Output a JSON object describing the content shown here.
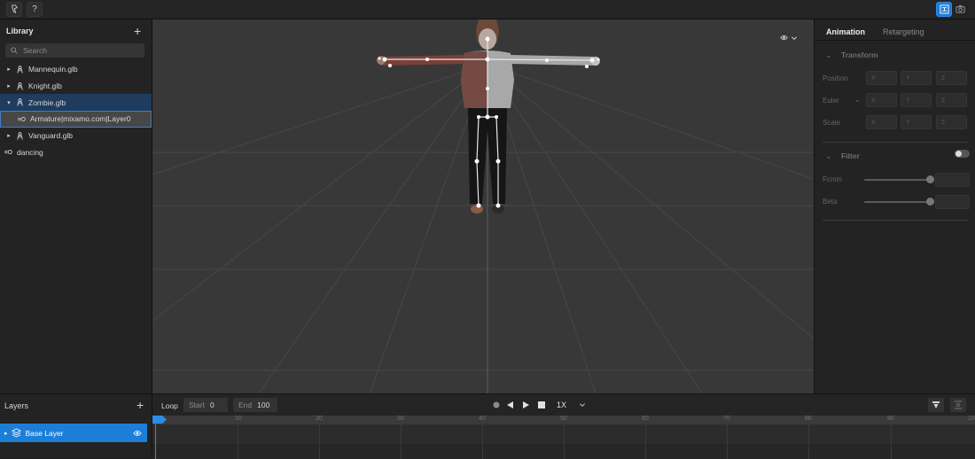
{
  "colors": {
    "accent": "#1e7bd6",
    "selected_row": "#1f3c5e",
    "bg": "#1e1e1e",
    "panel": "#232323",
    "viewport": "#383838"
  },
  "toolbar": {
    "left_icons": [
      "feedback-icon",
      "help-icon"
    ],
    "help_label": "?",
    "right_icons": [
      "layout-icon",
      "camera-icon"
    ]
  },
  "library": {
    "title": "Library",
    "search_placeholder": "Search",
    "items": [
      {
        "label": "Mannequin.glb",
        "icon": "figure-icon",
        "expander": "▸"
      },
      {
        "label": "Knight.glb",
        "icon": "figure-icon",
        "expander": "▸"
      },
      {
        "label": "Zombie.glb",
        "icon": "figure-icon",
        "expander": "▾"
      },
      {
        "label": "Armature|mixamo.com|Layer0",
        "icon": "animation-icon"
      },
      {
        "label": "Vanguard.glb",
        "icon": "figure-icon",
        "expander": "▸"
      },
      {
        "label": "dancing",
        "icon": "animation-icon"
      }
    ]
  },
  "properties": {
    "tabs": [
      "Animation",
      "Retargeting"
    ],
    "transform": {
      "title": "Transform",
      "rows": [
        "Position",
        "Euler",
        "Scale"
      ],
      "axes": [
        "X",
        "Y",
        "Z"
      ]
    },
    "filter": {
      "title": "Filter",
      "rows": [
        "Fcmin",
        "Beta"
      ],
      "enabled": false
    }
  },
  "layers": {
    "title": "Layers",
    "items": [
      {
        "label": "Base Layer"
      }
    ]
  },
  "timeline": {
    "loop_label": "Loop",
    "start_label": "Start",
    "start_value": "0",
    "end_label": "End",
    "end_value": "100",
    "speed": "1X",
    "ticks": [
      "0",
      "10",
      "20",
      "30",
      "40",
      "50",
      "60",
      "70",
      "80",
      "90",
      "10"
    ]
  }
}
